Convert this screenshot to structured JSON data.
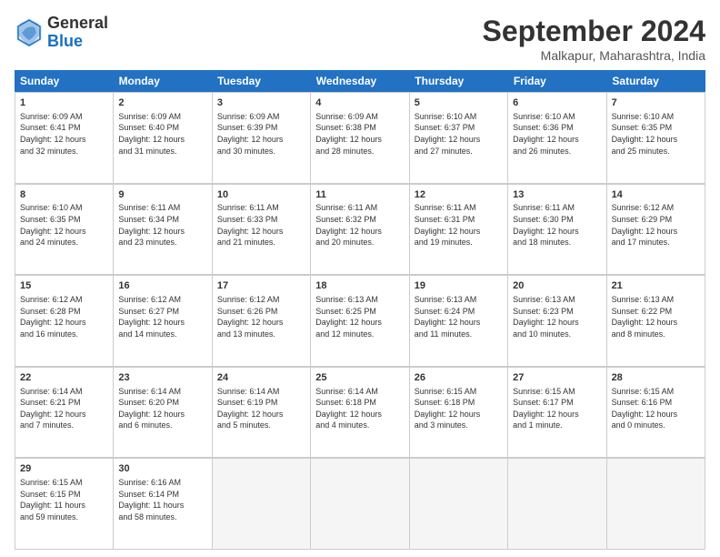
{
  "header": {
    "logo_line1": "General",
    "logo_line2": "Blue",
    "month": "September 2024",
    "location": "Malkapur, Maharashtra, India"
  },
  "weekdays": [
    "Sunday",
    "Monday",
    "Tuesday",
    "Wednesday",
    "Thursday",
    "Friday",
    "Saturday"
  ],
  "weeks": [
    [
      {
        "day": "1",
        "info": "Sunrise: 6:09 AM\nSunset: 6:41 PM\nDaylight: 12 hours\nand 32 minutes."
      },
      {
        "day": "2",
        "info": "Sunrise: 6:09 AM\nSunset: 6:40 PM\nDaylight: 12 hours\nand 31 minutes."
      },
      {
        "day": "3",
        "info": "Sunrise: 6:09 AM\nSunset: 6:39 PM\nDaylight: 12 hours\nand 30 minutes."
      },
      {
        "day": "4",
        "info": "Sunrise: 6:09 AM\nSunset: 6:38 PM\nDaylight: 12 hours\nand 28 minutes."
      },
      {
        "day": "5",
        "info": "Sunrise: 6:10 AM\nSunset: 6:37 PM\nDaylight: 12 hours\nand 27 minutes."
      },
      {
        "day": "6",
        "info": "Sunrise: 6:10 AM\nSunset: 6:36 PM\nDaylight: 12 hours\nand 26 minutes."
      },
      {
        "day": "7",
        "info": "Sunrise: 6:10 AM\nSunset: 6:35 PM\nDaylight: 12 hours\nand 25 minutes."
      }
    ],
    [
      {
        "day": "8",
        "info": "Sunrise: 6:10 AM\nSunset: 6:35 PM\nDaylight: 12 hours\nand 24 minutes."
      },
      {
        "day": "9",
        "info": "Sunrise: 6:11 AM\nSunset: 6:34 PM\nDaylight: 12 hours\nand 23 minutes."
      },
      {
        "day": "10",
        "info": "Sunrise: 6:11 AM\nSunset: 6:33 PM\nDaylight: 12 hours\nand 21 minutes."
      },
      {
        "day": "11",
        "info": "Sunrise: 6:11 AM\nSunset: 6:32 PM\nDaylight: 12 hours\nand 20 minutes."
      },
      {
        "day": "12",
        "info": "Sunrise: 6:11 AM\nSunset: 6:31 PM\nDaylight: 12 hours\nand 19 minutes."
      },
      {
        "day": "13",
        "info": "Sunrise: 6:11 AM\nSunset: 6:30 PM\nDaylight: 12 hours\nand 18 minutes."
      },
      {
        "day": "14",
        "info": "Sunrise: 6:12 AM\nSunset: 6:29 PM\nDaylight: 12 hours\nand 17 minutes."
      }
    ],
    [
      {
        "day": "15",
        "info": "Sunrise: 6:12 AM\nSunset: 6:28 PM\nDaylight: 12 hours\nand 16 minutes."
      },
      {
        "day": "16",
        "info": "Sunrise: 6:12 AM\nSunset: 6:27 PM\nDaylight: 12 hours\nand 14 minutes."
      },
      {
        "day": "17",
        "info": "Sunrise: 6:12 AM\nSunset: 6:26 PM\nDaylight: 12 hours\nand 13 minutes."
      },
      {
        "day": "18",
        "info": "Sunrise: 6:13 AM\nSunset: 6:25 PM\nDaylight: 12 hours\nand 12 minutes."
      },
      {
        "day": "19",
        "info": "Sunrise: 6:13 AM\nSunset: 6:24 PM\nDaylight: 12 hours\nand 11 minutes."
      },
      {
        "day": "20",
        "info": "Sunrise: 6:13 AM\nSunset: 6:23 PM\nDaylight: 12 hours\nand 10 minutes."
      },
      {
        "day": "21",
        "info": "Sunrise: 6:13 AM\nSunset: 6:22 PM\nDaylight: 12 hours\nand 8 minutes."
      }
    ],
    [
      {
        "day": "22",
        "info": "Sunrise: 6:14 AM\nSunset: 6:21 PM\nDaylight: 12 hours\nand 7 minutes."
      },
      {
        "day": "23",
        "info": "Sunrise: 6:14 AM\nSunset: 6:20 PM\nDaylight: 12 hours\nand 6 minutes."
      },
      {
        "day": "24",
        "info": "Sunrise: 6:14 AM\nSunset: 6:19 PM\nDaylight: 12 hours\nand 5 minutes."
      },
      {
        "day": "25",
        "info": "Sunrise: 6:14 AM\nSunset: 6:18 PM\nDaylight: 12 hours\nand 4 minutes."
      },
      {
        "day": "26",
        "info": "Sunrise: 6:15 AM\nSunset: 6:18 PM\nDaylight: 12 hours\nand 3 minutes."
      },
      {
        "day": "27",
        "info": "Sunrise: 6:15 AM\nSunset: 6:17 PM\nDaylight: 12 hours\nand 1 minute."
      },
      {
        "day": "28",
        "info": "Sunrise: 6:15 AM\nSunset: 6:16 PM\nDaylight: 12 hours\nand 0 minutes."
      }
    ],
    [
      {
        "day": "29",
        "info": "Sunrise: 6:15 AM\nSunset: 6:15 PM\nDaylight: 11 hours\nand 59 minutes."
      },
      {
        "day": "30",
        "info": "Sunrise: 6:16 AM\nSunset: 6:14 PM\nDaylight: 11 hours\nand 58 minutes."
      },
      {
        "day": "",
        "info": ""
      },
      {
        "day": "",
        "info": ""
      },
      {
        "day": "",
        "info": ""
      },
      {
        "day": "",
        "info": ""
      },
      {
        "day": "",
        "info": ""
      }
    ]
  ]
}
